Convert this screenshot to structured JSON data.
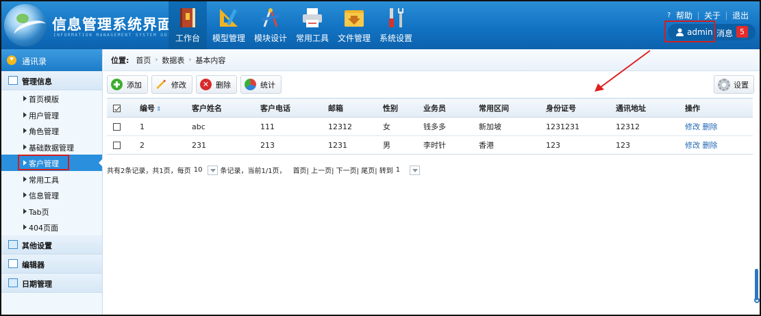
{
  "header": {
    "app_title": "信息管理系统界面",
    "app_subtitle": "INFORMATION MANAGEMENT SYSTEM GUI",
    "nav": [
      {
        "label": "工作台",
        "icon": "book-icon",
        "active": true
      },
      {
        "label": "模型管理",
        "icon": "ruler-pencil-icon"
      },
      {
        "label": "模块设计",
        "icon": "drafting-tools-icon"
      },
      {
        "label": "常用工具",
        "icon": "printer-icon"
      },
      {
        "label": "文件管理",
        "icon": "folder-download-icon"
      },
      {
        "label": "系统设置",
        "icon": "tools-icon"
      }
    ],
    "links": {
      "help": "帮助",
      "about": "关于",
      "logout": "退出"
    },
    "user": {
      "name": "admin",
      "messages_label": "消息",
      "messages_count": "5"
    },
    "accent_color": "#1273c3"
  },
  "sidebar": {
    "top_title": "通讯录",
    "groups": [
      {
        "title": "管理信息",
        "icon": "list-icon",
        "items": [
          "首页模版",
          "用户管理",
          "角色管理",
          "基础数据管理",
          "客户管理",
          "常用工具",
          "信息管理",
          "Tab页",
          "404页面"
        ],
        "active_item": "客户管理"
      },
      {
        "title": "其他设置",
        "icon": "chat-icon"
      },
      {
        "title": "编辑器",
        "icon": "edit-icon"
      },
      {
        "title": "日期管理",
        "icon": "calendar-icon"
      }
    ]
  },
  "breadcrumb": {
    "label": "位置:",
    "items": [
      "首页",
      "数据表",
      "基本内容"
    ]
  },
  "toolbar": {
    "add": "添加",
    "edit": "修改",
    "delete": "删除",
    "stats": "统计",
    "settings": "设置"
  },
  "table": {
    "columns": [
      "编号",
      "客户姓名",
      "客户电话",
      "邮箱",
      "性别",
      "业务员",
      "常用区间",
      "身份证号",
      "通讯地址",
      "操作"
    ],
    "rows": [
      {
        "id": "1",
        "name": "abc",
        "phone": "111",
        "email": "12312",
        "gender": "女",
        "salesman": "钱多多",
        "region": "新加坡",
        "id_card": "1231231",
        "address": "12312",
        "edit": "修改",
        "delete": "删除"
      },
      {
        "id": "2",
        "name": "231",
        "phone": "213",
        "email": "1231",
        "gender": "男",
        "salesman": "李时针",
        "region": "香港",
        "id_card": "123",
        "address": "123",
        "edit": "修改",
        "delete": "删除"
      }
    ]
  },
  "pager": {
    "summary": "共有2条记录，共1页，每页",
    "page_size": "10",
    "summary2": "条记录，当前1/1页，",
    "nav_text": "首页| 上一页| 下一页| 尾页| 转到",
    "goto_value": "1"
  }
}
